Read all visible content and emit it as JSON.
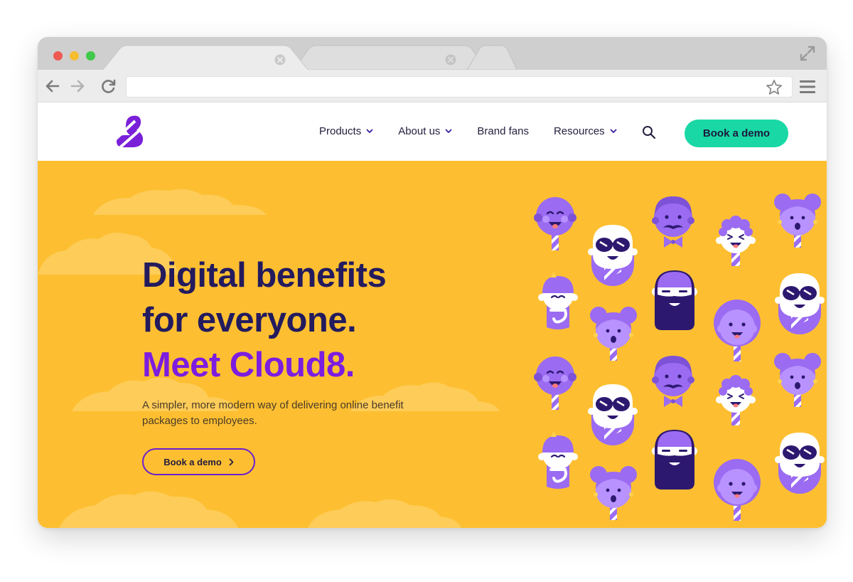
{
  "browser": {
    "tabs": [
      {
        "close_icon": "close-icon"
      },
      {
        "close_icon": "close-icon"
      }
    ],
    "url": "",
    "traffic_lights": [
      "#ee5a52",
      "#f5bd2f",
      "#3fc84a"
    ]
  },
  "nav": {
    "items": [
      {
        "label": "Products",
        "has_dropdown": true
      },
      {
        "label": "About us",
        "has_dropdown": true
      },
      {
        "label": "Brand fans",
        "has_dropdown": false
      },
      {
        "label": "Resources",
        "has_dropdown": true
      }
    ],
    "cta_label": "Book a demo"
  },
  "hero": {
    "headline_line1": "Digital benefits",
    "headline_line2": "for everyone.",
    "headline_line3": "Meet Cloud8.",
    "subtitle": "A simpler, more modern way of delivering online benefit packages to employees.",
    "button_label": "Book a demo"
  },
  "colors": {
    "hero_bg": "#fdbf31",
    "cta_bg": "#19d8a5",
    "brand_purple": "#7c1de0",
    "headline_dark": "#231b5e",
    "character_purple": "#9b6bf2"
  }
}
